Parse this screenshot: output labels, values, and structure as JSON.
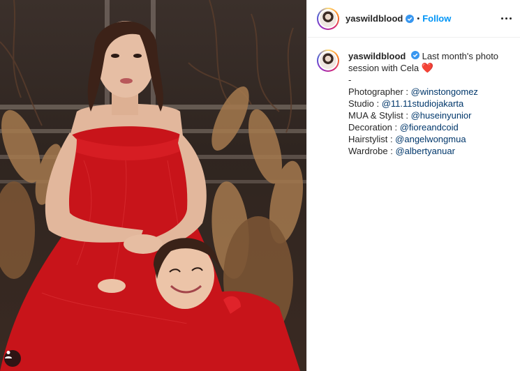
{
  "post": {
    "username": "yaswildblood",
    "separator": "•",
    "follow_label": "Follow",
    "caption": {
      "text_line1": "Last month's photo",
      "text_line2": "session with Cela",
      "heart": "❤️",
      "divider": "-",
      "credits": [
        {
          "label": "Photographer : ",
          "handle": "@winstongomez"
        },
        {
          "label": "Studio : ",
          "handle": "@11.11studiojakarta"
        },
        {
          "label": "MUA & Stylist : ",
          "handle": "@huseinyunior"
        },
        {
          "label": "Decoration : ",
          "handle": "@fioreandcoid"
        },
        {
          "label": "Hairstylist : ",
          "handle": "@angelwongmua"
        },
        {
          "label": "Wardrobe : ",
          "handle": "@albertyanuar"
        }
      ]
    }
  },
  "colors": {
    "follow_blue": "#0095f6",
    "mention_blue": "#00376b",
    "dress_red": "#d2141b",
    "heart_red": "#ed4956"
  },
  "icons": {
    "verified": "verified-badge-icon",
    "more": "more-options-icon",
    "user_tag": "user-tag-icon"
  }
}
